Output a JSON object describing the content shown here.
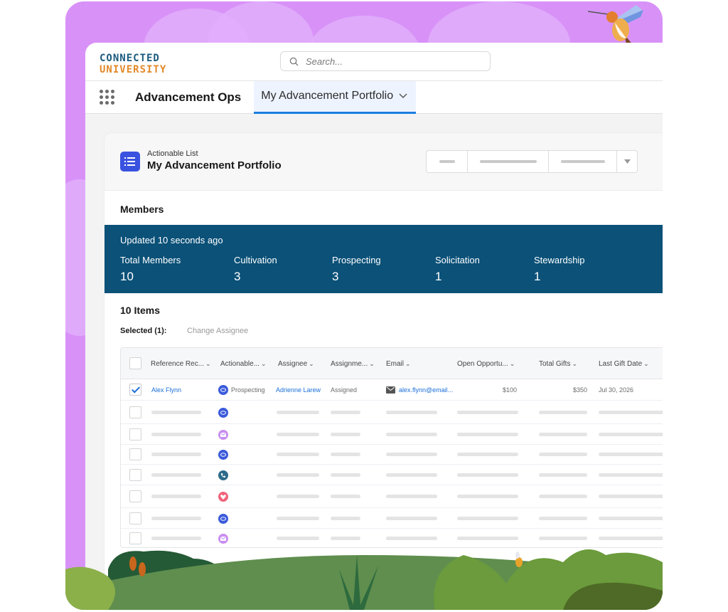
{
  "brand": {
    "line1": "CONNECTED",
    "line2": "UNIVERSITY",
    "colors": {
      "line1": "#1b5a7e",
      "line2": "#e2892a",
      "frame_bg": "#d892f7",
      "accent": "#1b7ee0",
      "stats_bg": "#0b5178"
    }
  },
  "search": {
    "placeholder": "Search...",
    "value": ""
  },
  "nav": {
    "app_name": "Advancement Ops",
    "active_tab": "My Advancement Portfolio"
  },
  "record": {
    "type": "Actionable List",
    "name": "My Advancement Portfolio"
  },
  "members": {
    "title": "Members",
    "updated": "Updated 10 seconds ago",
    "stats": [
      {
        "label": "Total Members",
        "value": "10"
      },
      {
        "label": "Cultivation",
        "value": "3"
      },
      {
        "label": "Prospecting",
        "value": "3"
      },
      {
        "label": "Solicitation",
        "value": "1"
      },
      {
        "label": "Stewardship",
        "value": "1"
      }
    ]
  },
  "list": {
    "items_count": "10 Items",
    "selected": "Selected (1):",
    "change_assignee": "Change Assignee",
    "columns": [
      "Reference Rec...",
      "Actionable...",
      "Assignee",
      "Assignme...",
      "Email",
      "Open Opportu...",
      "Total Gifts",
      "Last Gift Date"
    ],
    "rows": [
      {
        "checked": true,
        "reference": "Alex Flynn",
        "icon": "prospecting-icon",
        "actionable": "Prospecting",
        "assignee": "Adrienne Larew",
        "assignment_status": "Assigned",
        "email": "alex.flynn@email...",
        "open_opportunities": "$100",
        "total_gifts": "$350",
        "last_gift_date": "Jul 30, 2026"
      },
      {
        "checked": false,
        "icon": "prospecting-icon"
      },
      {
        "checked": false,
        "icon": "email-icon"
      },
      {
        "checked": false,
        "icon": "prospecting-icon"
      },
      {
        "checked": false,
        "icon": "phone-icon"
      },
      {
        "checked": false,
        "icon": "heart-icon"
      },
      {
        "checked": false,
        "icon": "prospecting-icon"
      },
      {
        "checked": false,
        "icon": "email-icon"
      }
    ]
  }
}
